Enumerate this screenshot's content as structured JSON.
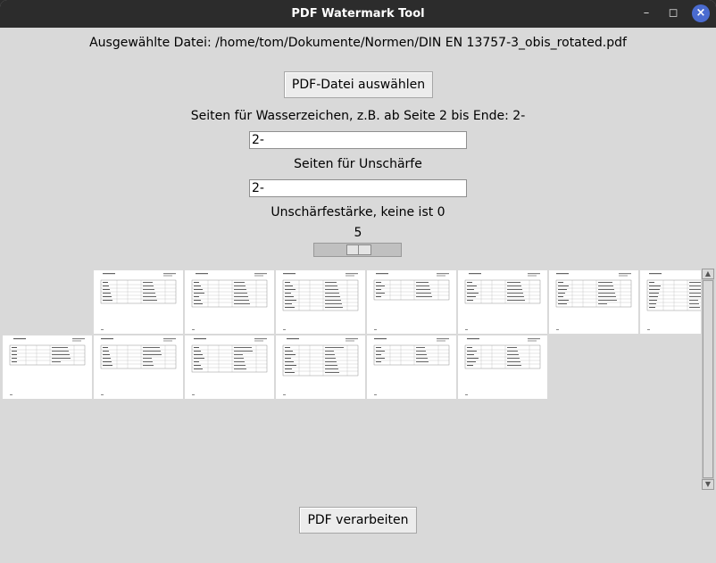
{
  "window": {
    "title": "PDF Watermark Tool"
  },
  "selected_file_label": "Ausgewählte Datei: /home/tom/Dokumente/Normen/DIN EN 13757-3_obis_rotated.pdf",
  "select_button_label": "PDF-Datei auswählen",
  "watermark_pages_label": "Seiten für Wasserzeichen, z.B. ab Seite 2 bis Ende: 2-",
  "watermark_pages_value": "2-",
  "blur_pages_label": "Seiten für Unschärfe",
  "blur_pages_value": "2-",
  "blur_strength_label": "Unschärfestärke, keine ist 0",
  "blur_strength_value": "5",
  "page_thumbnails_count": 13,
  "process_button_label": "PDF verarbeiten",
  "icons": [
    "minimize-icon",
    "maximize-icon",
    "close-icon"
  ]
}
